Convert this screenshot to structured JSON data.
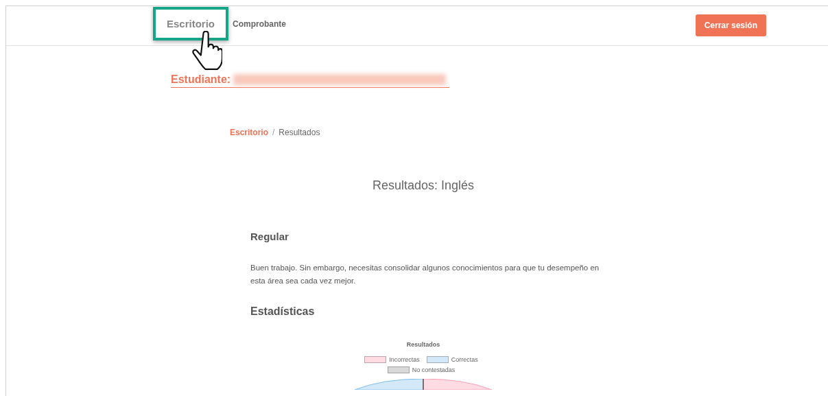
{
  "nav": {
    "items": [
      {
        "label": "Escritorio",
        "selected": true
      },
      {
        "label": "Comprobante",
        "selected": false
      }
    ],
    "logout": "Cerrar sesión"
  },
  "student": {
    "label": "Estudiante:",
    "name_redacted": true
  },
  "breadcrumb": {
    "separator": "/",
    "items": [
      {
        "label": "Escritorio",
        "link": true
      },
      {
        "label": "Resultados",
        "link": false
      }
    ]
  },
  "title": "Resultados: Inglés",
  "result_level": "Regular",
  "message": "Buen trabajo. Sin embargo, necesitas consolidar algunos conocimientos para que tu desempeño en esta área sea cada vez mejor.",
  "stats_heading": "Estadísticas",
  "chart": {
    "title": "Resultados",
    "legend": [
      {
        "label": "Incorrectas",
        "color": "#ffdce3"
      },
      {
        "label": "Correctas",
        "color": "#d3e9f9"
      },
      {
        "label": "No contestadas",
        "color": "#d9d9d9"
      }
    ]
  }
}
